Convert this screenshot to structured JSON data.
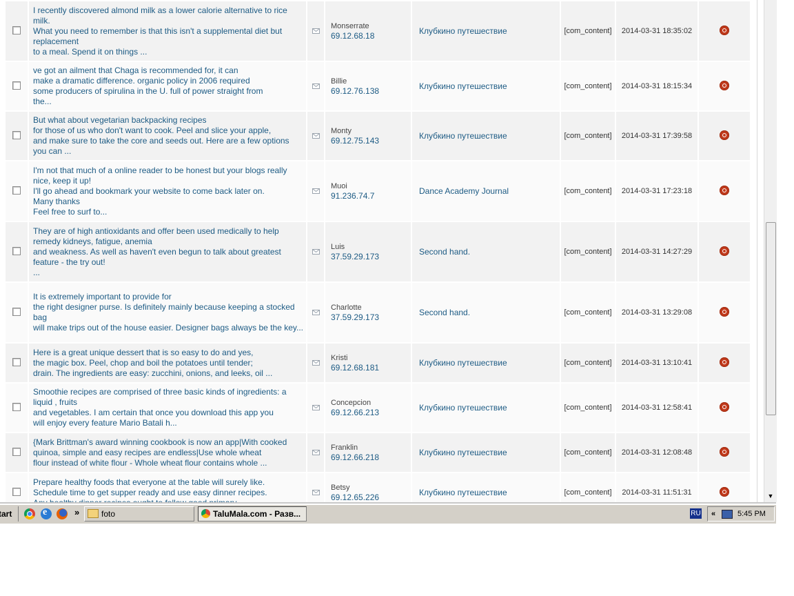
{
  "comments": [
    {
      "lines": [
        "I recently discovered almond milk as a lower calorie alternative to rice milk.",
        "What you need to remember is that this isn't a supplemental diet but replacement",
        "to a meal. Spend it on things ..."
      ],
      "author": "Monserrate",
      "ip": "69.12.68.18",
      "item": "Клубкино путешествие",
      "component": "[com_content]",
      "date": "2014-03-31 18:35:02"
    },
    {
      "lines": [
        "ve got an ailment that Chaga is recommended for, it can",
        "make a dramatic difference. organic policy in 2006 required",
        "some producers of spirulina in the U. full of power straight from",
        "the..."
      ],
      "author": "Billie",
      "ip": "69.12.76.138",
      "item": "Клубкино путешествие",
      "component": "[com_content]",
      "date": "2014-03-31 18:15:34"
    },
    {
      "lines": [
        "But what about vegetarian backpacking recipes",
        "for those of us who don't want to cook. Peel and slice your apple,",
        "and make sure to take the core and seeds out. Here are a few options",
        "you can ..."
      ],
      "author": "Monty",
      "ip": "69.12.75.143",
      "item": "Клубкино путешествие",
      "component": "[com_content]",
      "date": "2014-03-31 17:39:58"
    },
    {
      "lines": [
        "I'm not that much of a online reader to be honest but your blogs really nice, keep it up!",
        "I'll go ahead and bookmark your website to come back later on.",
        "Many thanks",
        "Feel free to surf to..."
      ],
      "author": "Muoi",
      "ip": "91.236.74.7",
      "item": "Dance Academy Journal",
      "component": "[com_content]",
      "date": "2014-03-31 17:23:18"
    },
    {
      "lines": [
        "They are of high antioxidants and offer been used medically to help remedy kidneys, fatigue, anemia",
        "and weakness. As well as haven't even begun to talk about greatest feature - the try out!",
        "..."
      ],
      "author": "Luis",
      "ip": "37.59.29.173",
      "item": "Second hand.",
      "component": "[com_content]",
      "date": "2014-03-31 14:27:29"
    },
    {
      "lines": [
        "It is extremely important to provide for",
        "the right designer purse. Is definitely mainly because keeping a stocked bag",
        "will make trips out of the house easier. Designer bags always be the key..."
      ],
      "author": "Charlotte",
      "ip": "37.59.29.173",
      "item": "Second hand.",
      "component": "[com_content]",
      "date": "2014-03-31 13:29:08"
    },
    {
      "lines": [
        "Here is a great unique dessert that is so easy to do and yes,",
        "the magic box. Peel, chop and boil the potatoes until tender;",
        "drain. The ingredients are easy: zucchini, onions, and leeks, oil ..."
      ],
      "author": "Kristi",
      "ip": "69.12.68.181",
      "item": "Клубкино путешествие",
      "component": "[com_content]",
      "date": "2014-03-31 13:10:41"
    },
    {
      "lines": [
        "Smoothie recipes are comprised of three basic kinds of ingredients: a liquid , fruits",
        "and vegetables. I am certain that once you download this app you",
        "will enjoy every feature Mario Batali h..."
      ],
      "author": "Concepcion",
      "ip": "69.12.66.213",
      "item": "Клубкино путешествие",
      "component": "[com_content]",
      "date": "2014-03-31 12:58:41"
    },
    {
      "lines": [
        "{Mark Brittman's award winning cookbook is now an app|With cooked",
        "quinoa, simple and easy recipes are endless|Use whole wheat",
        "flour instead of white flour - Whole wheat flour contains whole ..."
      ],
      "author": "Franklin",
      "ip": "69.12.66.218",
      "item": "Клубкино путешествие",
      "component": "[com_content]",
      "date": "2014-03-31 12:08:48"
    },
    {
      "lines": [
        "Prepare healthy foods that everyone at the table will surely like.",
        "Schedule time to get supper ready and use easy dinner recipes.",
        "Any healthy dinner recipes ought to follow good primary"
      ],
      "author": "Betsy",
      "ip": "69.12.65.226",
      "item": "Клубкино путешествие",
      "component": "[com_content]",
      "date": "2014-03-31 11:51:31"
    }
  ],
  "taskbar": {
    "start_label": "Start",
    "more_label": "»",
    "tasks": [
      {
        "label": "foto"
      },
      {
        "label": "TaluMala.com - Разв..."
      }
    ],
    "lang": "RU",
    "chevron": "«",
    "clock": "5:45 PM"
  },
  "colors": {
    "link": "#1d5b84",
    "status": "#c0391b",
    "taskbar": "#d4d0c8"
  }
}
